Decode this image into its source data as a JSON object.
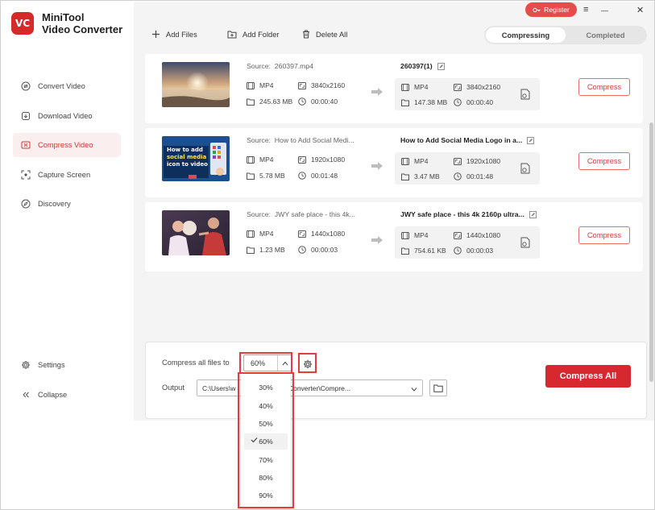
{
  "app": {
    "logo_mark": "VC",
    "name_line1": "MiniTool",
    "name_line2": "Video Converter"
  },
  "window": {
    "register_label": "Register",
    "menu_icon": "≡",
    "minimize_icon": "—",
    "close_icon": "✕"
  },
  "sidebar": {
    "items": [
      {
        "label": "Convert Video",
        "icon": "convert-icon"
      },
      {
        "label": "Download Video",
        "icon": "download-icon"
      },
      {
        "label": "Compress Video",
        "icon": "compress-icon",
        "active": true
      },
      {
        "label": "Capture Screen",
        "icon": "capture-icon"
      },
      {
        "label": "Discovery",
        "icon": "compass-icon"
      }
    ],
    "bottom": [
      {
        "label": "Settings",
        "icon": "gear-icon"
      },
      {
        "label": "Collapse",
        "icon": "double-chevron-left-icon"
      }
    ]
  },
  "toolbar": {
    "add_files": "Add Files",
    "add_folder": "Add Folder",
    "delete_all": "Delete All"
  },
  "tabs": {
    "compressing": "Compressing",
    "completed": "Completed",
    "active": "compressing"
  },
  "files": [
    {
      "source_label": "Source:",
      "source_name": "260397.mp4",
      "format": "MP4",
      "resolution": "3840x2160",
      "size": "245.63 MB",
      "duration": "00:00:40",
      "output_name": "260397(1)",
      "out_format": "MP4",
      "out_resolution": "3840x2160",
      "out_size": "147.38 MB",
      "out_duration": "00:00:40",
      "button": "Compress"
    },
    {
      "source_label": "Source:",
      "source_name": "How to Add Social Medi...",
      "format": "MP4",
      "resolution": "1920x1080",
      "size": "5.78 MB",
      "duration": "00:01:48",
      "output_name": "How to Add Social Media Logo in a...",
      "out_format": "MP4",
      "out_resolution": "1920x1080",
      "out_size": "3.47 MB",
      "out_duration": "00:01:48",
      "button": "Compress",
      "thumb_text": [
        "How to add",
        "social media",
        "icon to video"
      ]
    },
    {
      "source_label": "Source:",
      "source_name": "JWY safe place - this 4k...",
      "format": "MP4",
      "resolution": "1440x1080",
      "size": "1.23 MB",
      "duration": "00:00:03",
      "output_name": "JWY safe place - this 4k 2160p ultra...",
      "out_format": "MP4",
      "out_resolution": "1440x1080",
      "out_size": "754.61 KB",
      "out_duration": "00:00:03",
      "button": "Compress"
    }
  ],
  "bottom_panel": {
    "compress_label": "Compress all files to",
    "selected_percent": "60%",
    "output_label": "Output",
    "output_path": "C:\\Users\\w",
    "output_path_tail": "iniTool Video Converter\\Compre...",
    "compress_all": "Compress All"
  },
  "dropdown": {
    "options": [
      "30%",
      "40%",
      "50%",
      "60%",
      "70%",
      "80%",
      "90%"
    ],
    "selected": "60%"
  },
  "colors": {
    "accent": "#d7282f",
    "highlight": "#e63b3b",
    "sidebar_active_bg": "#fbeeee"
  }
}
